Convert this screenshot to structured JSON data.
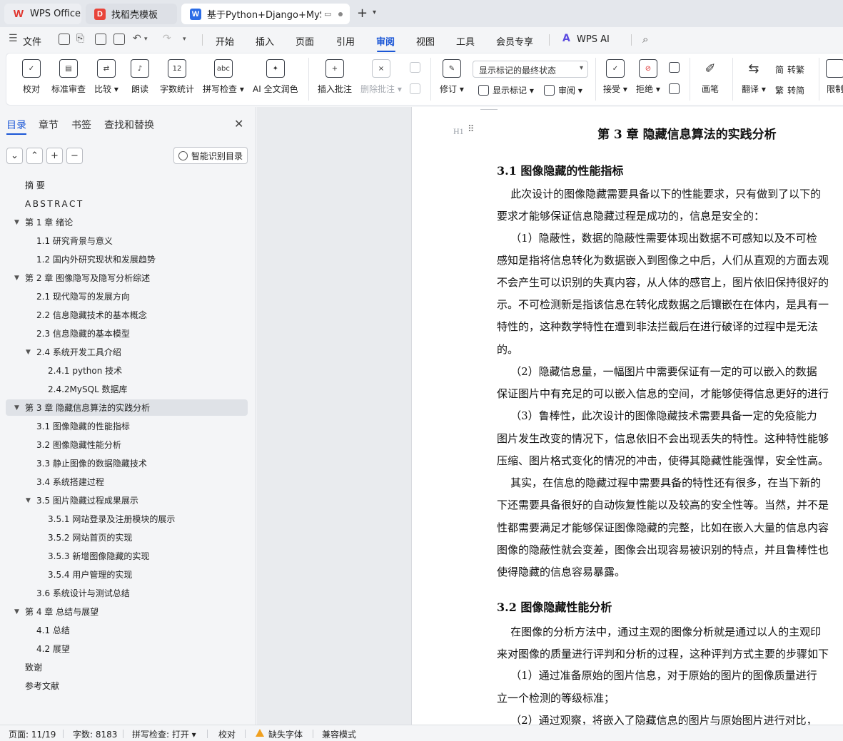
{
  "tabs": {
    "wps": "WPS Office",
    "docer": "找稻壳模板",
    "doc": "基于Python+Django+MySQL"
  },
  "menu": {
    "file": "文件",
    "items": [
      "开始",
      "插入",
      "页面",
      "引用",
      "审阅",
      "视图",
      "工具",
      "会员专享",
      "WPS AI"
    ],
    "active": "审阅"
  },
  "ribbon": {
    "proofread": "校对",
    "standard_review": "标准审查",
    "compare": "比较",
    "read_aloud": "朗读",
    "word_count": "字数统计",
    "spell_check": "拼写检查",
    "ai_polish": "AI 全文润色",
    "insert_comment": "插入批注",
    "delete_comment": "删除批注",
    "track_changes": "修订",
    "markup_select": "显示标记的最终状态",
    "show_markup": "显示标记",
    "review": "审阅",
    "accept": "接受",
    "reject": "拒绝",
    "pen": "画笔",
    "translate": "翻译",
    "to_traditional": "转繁",
    "to_simplified": "转简",
    "restrict": "限制"
  },
  "nav": {
    "tabs": [
      "目录",
      "章节",
      "书签",
      "查找和替换"
    ],
    "smart_toc": "智能识别目录",
    "toc": [
      {
        "label": "摘  要",
        "level": 1,
        "caret": false
      },
      {
        "label": "ABSTRACT",
        "level": 1,
        "caret": false
      },
      {
        "label": "第 1 章  绪论",
        "level": 1,
        "caret": true
      },
      {
        "label": "1.1  研究背景与意义",
        "level": 2,
        "caret": false
      },
      {
        "label": "1.2  国内外研究现状和发展趋势",
        "level": 2,
        "caret": false
      },
      {
        "label": "第 2 章  图像隐写及隐写分析综述",
        "level": 1,
        "caret": true
      },
      {
        "label": "2.1  现代隐写的发展方向",
        "level": 2,
        "caret": false
      },
      {
        "label": "2.2 信息隐藏技术的基本概念",
        "level": 2,
        "caret": false
      },
      {
        "label": "2.3 信息隐藏的基本模型",
        "level": 2,
        "caret": false
      },
      {
        "label": "2.4 系统开发工具介绍",
        "level": 2,
        "caret": true
      },
      {
        "label": "2.4.1 python 技术",
        "level": 3,
        "caret": false
      },
      {
        "label": "2.4.2MySQL 数据库",
        "level": 3,
        "caret": false
      },
      {
        "label": "第 3 章  隐藏信息算法的实践分析",
        "level": 1,
        "caret": true,
        "selected": true
      },
      {
        "label": "3.1  图像隐藏的性能指标",
        "level": 2,
        "caret": false
      },
      {
        "label": "3.2  图像隐藏性能分析",
        "level": 2,
        "caret": false
      },
      {
        "label": "3.3 静止图像的数据隐藏技术",
        "level": 2,
        "caret": false
      },
      {
        "label": "3.4  系统搭建过程",
        "level": 2,
        "caret": false
      },
      {
        "label": "3.5  图片隐藏过程成果展示",
        "level": 2,
        "caret": true
      },
      {
        "label": "3.5.1 网站登录及注册模块的展示",
        "level": 3,
        "caret": false
      },
      {
        "label": "3.5.2 网站首页的实现",
        "level": 3,
        "caret": false
      },
      {
        "label": "3.5.3 新增图像隐藏的实现",
        "level": 3,
        "caret": false
      },
      {
        "label": "3.5.4 用户管理的实现",
        "level": 3,
        "caret": false
      },
      {
        "label": "3.6 系统设计与测试总结",
        "level": 2,
        "caret": false
      },
      {
        "label": "第 4 章  总结与展望",
        "level": 1,
        "caret": true
      },
      {
        "label": "4.1 总结",
        "level": 2,
        "caret": false
      },
      {
        "label": "4.2 展望",
        "level": 2,
        "caret": false
      },
      {
        "label": "致谢",
        "level": 1,
        "caret": false
      },
      {
        "label": "参考文献",
        "level": 1,
        "caret": false
      }
    ]
  },
  "document": {
    "h1_marker": "H1",
    "lines": [
      {
        "type": "h1",
        "text": "第 3 章  隐藏信息算法的实践分析"
      },
      {
        "type": "h2",
        "text": "3.1  图像隐藏的性能指标"
      },
      {
        "type": "p",
        "text": "    此次设计的图像隐藏需要具备以下的性能要求，只有做到了以下的"
      },
      {
        "type": "p",
        "text": "要求才能够保证信息隐藏过程是成功的，信息是安全的："
      },
      {
        "type": "p",
        "text": "    （1）隐蔽性，数据的隐蔽性需要体现出数据不可感知以及不可检"
      },
      {
        "type": "p",
        "text": "感知是指将信息转化为数据嵌入到图像之中后，人们从直观的方面去观"
      },
      {
        "type": "p",
        "text": "不会产生可以识别的失真内容，从人体的感官上，图片依旧保持很好的"
      },
      {
        "type": "p",
        "text": "示。不可检测新是指该信息在转化成数据之后镶嵌在在体内，是具有一"
      },
      {
        "type": "p",
        "text": "特性的，这种数学特性在遭到非法拦截后在进行破译的过程中是无法"
      },
      {
        "type": "p",
        "text": "的。"
      },
      {
        "type": "p",
        "text": "    （2）隐藏信息量，一幅图片中需要保证有一定的可以嵌入的数据"
      },
      {
        "type": "p",
        "text": "保证图片中有充足的可以嵌入信息的空间，才能够使得信息更好的进行"
      },
      {
        "type": "p",
        "text": "    （3）鲁棒性，此次设计的图像隐藏技术需要具备一定的免疫能力"
      },
      {
        "type": "p",
        "text": "图片发生改变的情况下，信息依旧不会出现丢失的特性。这种特性能够"
      },
      {
        "type": "p",
        "text": "压缩、图片格式变化的情况的冲击，使得其隐藏性能强悍，安全性高。"
      },
      {
        "type": "p",
        "text": "    其实，在信息的隐藏过程中需要具备的特性还有很多，在当下新的"
      },
      {
        "type": "p",
        "text": "下还需要具备很好的自动恢复性能以及较高的安全性等。当然，并不是"
      },
      {
        "type": "p",
        "text": "性都需要满足才能够保证图像隐藏的完整，比如在嵌入大量的信息内容"
      },
      {
        "type": "p",
        "text": "图像的隐蔽性就会变差，图像会出现容易被识别的特点，并且鲁棒性也"
      },
      {
        "type": "p",
        "text": "使得隐藏的信息容易暴露。"
      },
      {
        "type": "h2",
        "text": "3.2  图像隐藏性能分析"
      },
      {
        "type": "p",
        "text": "    在图像的分析方法中，通过主观的图像分析就是通过以人的主观印"
      },
      {
        "type": "p",
        "text": "来对图像的质量进行评判和分析的过程，这种评判方式主要的步骤如下"
      },
      {
        "type": "p",
        "text": "    （1）通过准备原始的图片信息，对于原始的图片的图像质量进行"
      },
      {
        "type": "p",
        "text": "立一个检测的等级标准；"
      },
      {
        "type": "p",
        "text": "    （2）通过观察，将嵌入了隐藏信息的图片与原始图片进行对比，"
      }
    ]
  },
  "status": {
    "page": "页面: 11/19",
    "words": "字数: 8183",
    "spell": "拼写检查: 打开",
    "proof": "校对",
    "missing_font": "缺失字体",
    "compat": "兼容模式"
  }
}
